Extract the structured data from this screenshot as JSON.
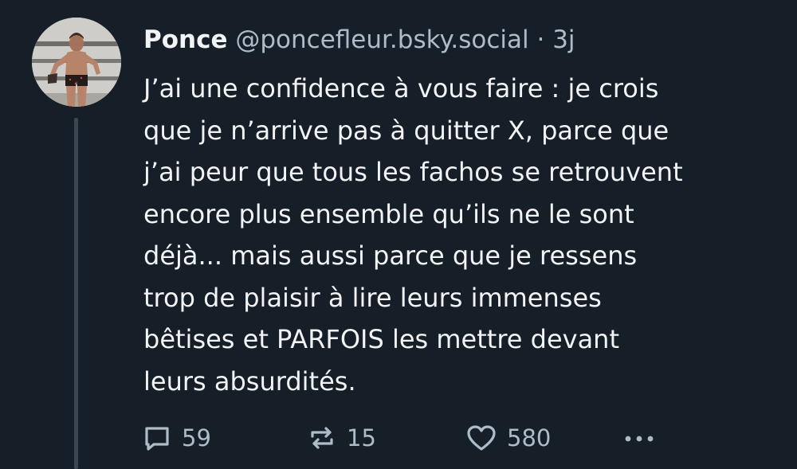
{
  "post": {
    "author": {
      "display_name": "Ponce",
      "handle": "@poncefleur.bsky.social",
      "separator": "·",
      "time": "3j"
    },
    "text_lines": [
      "J’ai une confidence à vous faire : je crois",
      "que je n’arrive pas à quitter X, parce que",
      "j’ai peur que tous les fachos se retrouvent",
      "encore plus ensemble qu’ils ne le sont",
      "déjà... mais aussi parce que je ressens",
      "trop de plaisir à lire leurs immenses",
      "bêtises et PARFOIS les mettre devant",
      "leurs absurdités."
    ],
    "actions": {
      "reply": {
        "icon": "reply-bubble-icon",
        "count": "59"
      },
      "repost": {
        "icon": "repost-arrows-icon",
        "count": "15"
      },
      "like": {
        "icon": "heart-icon",
        "count": "580"
      },
      "more": {
        "icon": "more-dots-icon"
      }
    }
  },
  "colors": {
    "background": "#161e27",
    "text": "#f1f3f5",
    "muted": "#aebbc9",
    "thread_line": "#3c4754"
  }
}
